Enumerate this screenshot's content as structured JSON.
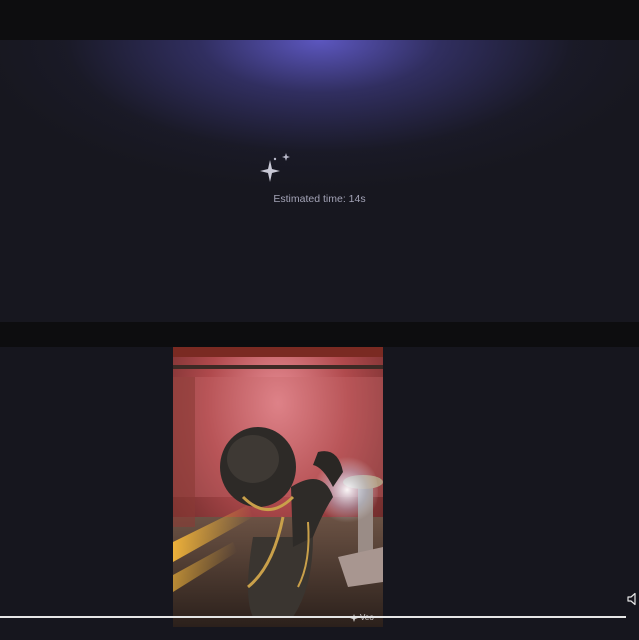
{
  "generation": {
    "status_text": "Estimated time: 14s",
    "icon": "sparkle-icon",
    "glow_color": "#5c58c4"
  },
  "video": {
    "watermark_icon": "sparkle-icon",
    "watermark_text": "Veo",
    "volume_icon": "volume-icon",
    "progress": 0.98,
    "progress_color": "#e6e6e6"
  }
}
